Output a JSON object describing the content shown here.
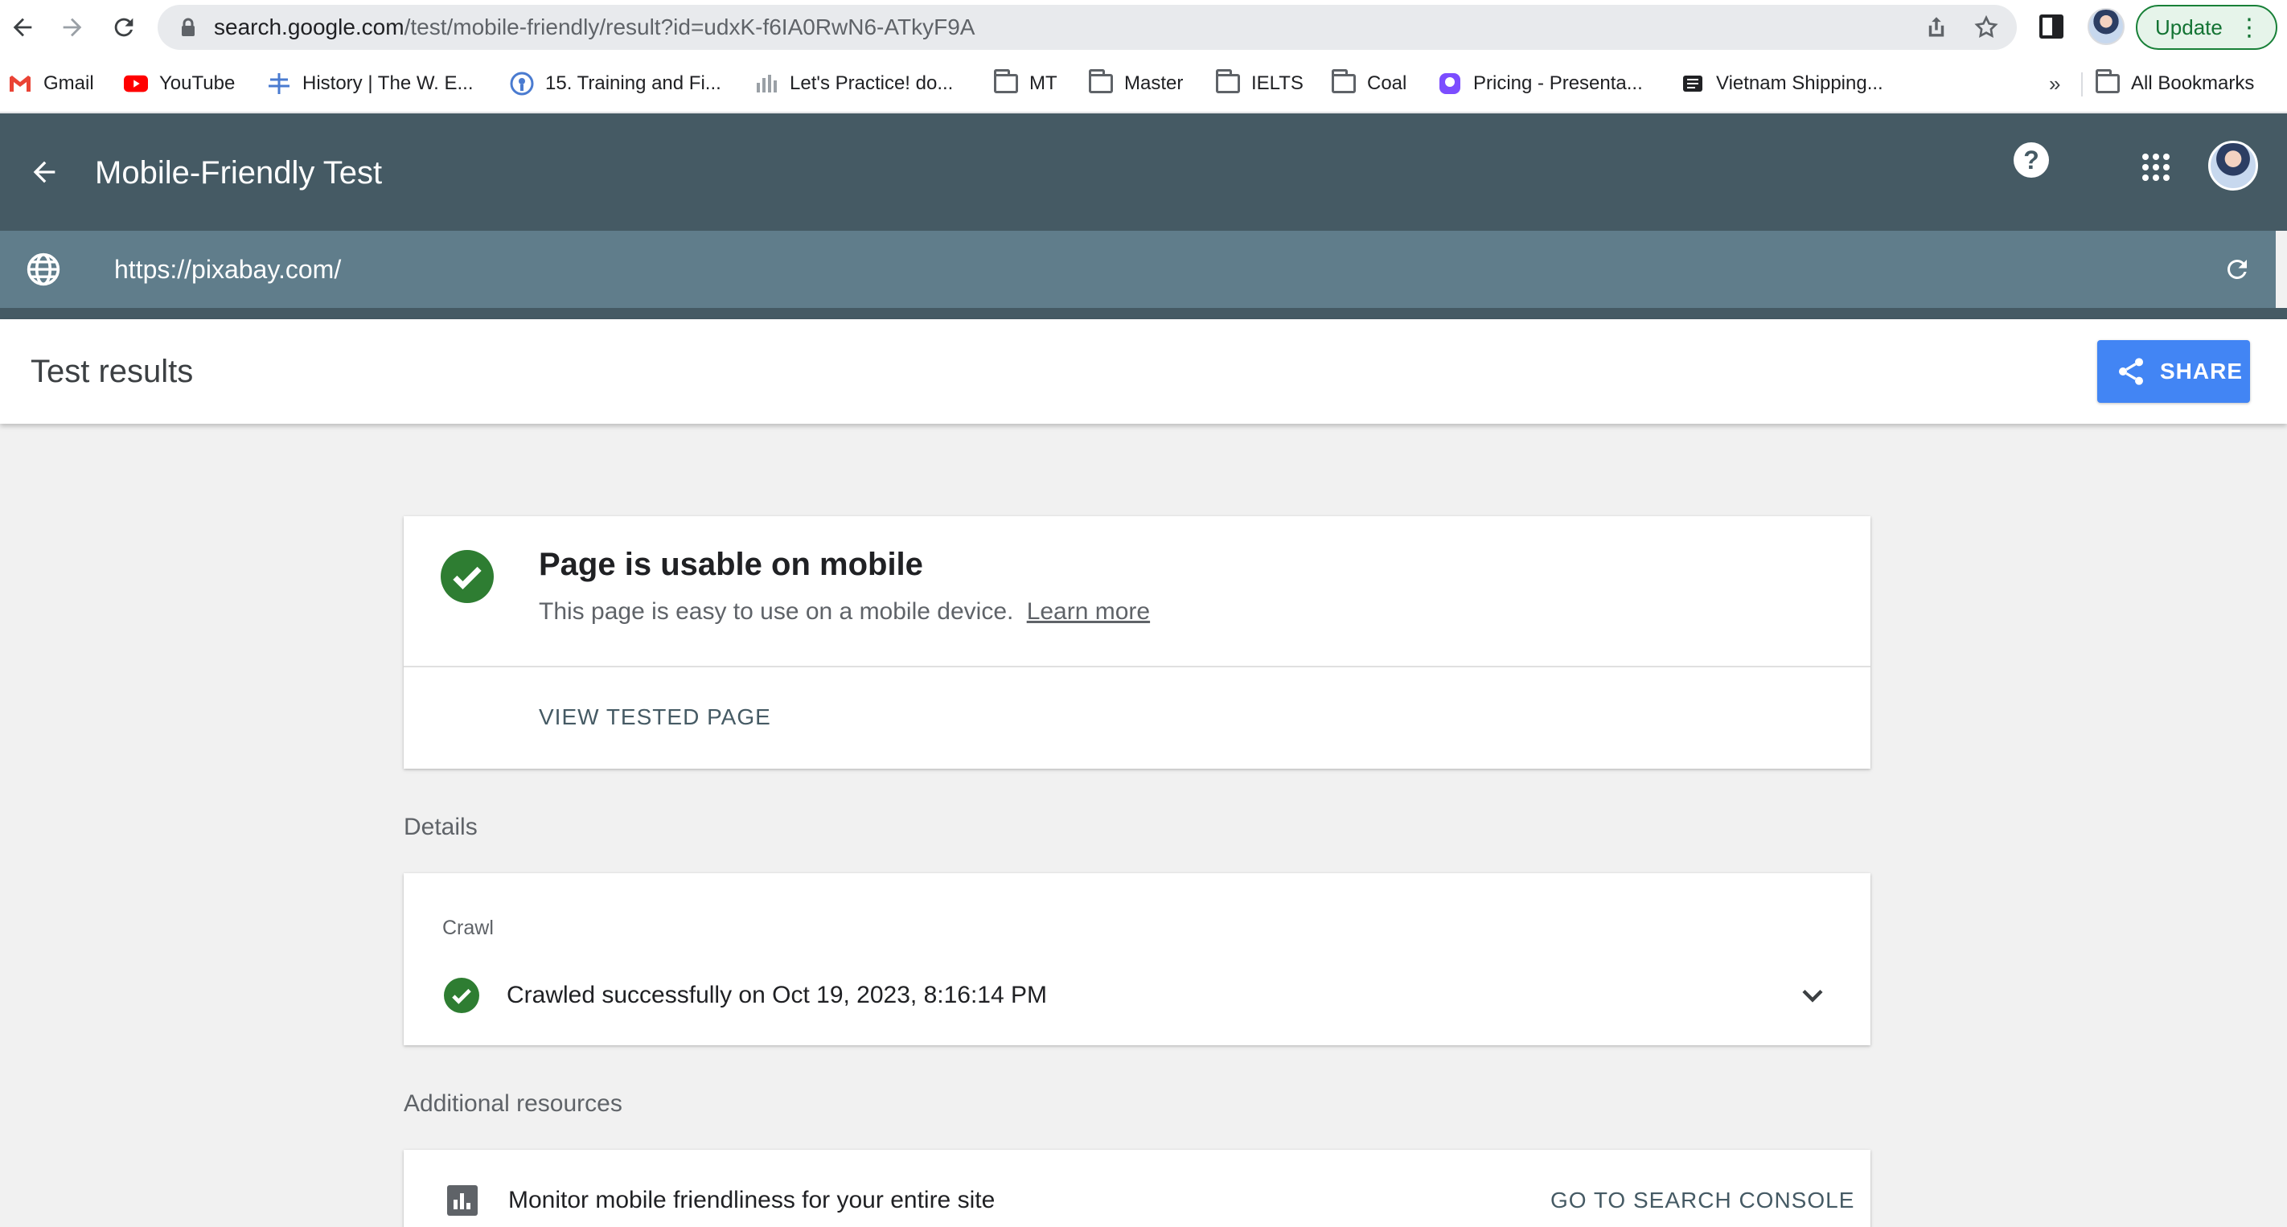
{
  "browser": {
    "url_host": "search.google.com",
    "url_path": "/test/mobile-friendly/result?id=udxK-f6IA0RwN6-ATkyF9A",
    "update_label": "Update",
    "icons": [
      "back-icon",
      "forward-icon",
      "reload-icon",
      "lock-icon",
      "share-icon",
      "star-icon",
      "side-panel-icon",
      "avatar",
      "more-icon"
    ]
  },
  "bookmarks": {
    "items": [
      {
        "label": "Gmail",
        "icon": "gmail-icon"
      },
      {
        "label": "YouTube",
        "icon": "youtube-icon"
      },
      {
        "label": "History | The W. E...",
        "icon": "history-icon"
      },
      {
        "label": "15. Training and Fi...",
        "icon": "training-icon"
      },
      {
        "label": "Let's Practice! do...",
        "icon": "practice-icon"
      },
      {
        "label": "MT",
        "icon": "folder-icon"
      },
      {
        "label": "Master",
        "icon": "folder-icon"
      },
      {
        "label": "IELTS",
        "icon": "folder-icon"
      },
      {
        "label": "Coal",
        "icon": "folder-icon"
      },
      {
        "label": "Pricing - Presenta...",
        "icon": "pricing-icon"
      },
      {
        "label": "Vietnam Shipping...",
        "icon": "shipping-icon"
      }
    ],
    "more": "»",
    "all_bookmarks": "All Bookmarks"
  },
  "app": {
    "title": "Mobile-Friendly Test",
    "tested_url": "https://pixabay.com/",
    "results_title": "Test results",
    "share_label": "SHARE",
    "help_glyph": "?"
  },
  "result": {
    "title": "Page is usable on mobile",
    "description": "This page is easy to use on a mobile device.",
    "learn_more": "Learn more",
    "view_tested_page": "VIEW TESTED PAGE"
  },
  "details": {
    "label": "Details",
    "crawl_label": "Crawl",
    "crawl_status": "Crawled successfully on Oct 19, 2023, 8:16:14 PM"
  },
  "resources": {
    "label": "Additional resources",
    "text": "Monitor mobile friendliness for your entire site",
    "link": "GO TO SEARCH CONSOLE"
  },
  "colors": {
    "header": "#455a64",
    "url_row": "#607d8b",
    "success": "#2e7d32",
    "share": "#4285f4"
  }
}
